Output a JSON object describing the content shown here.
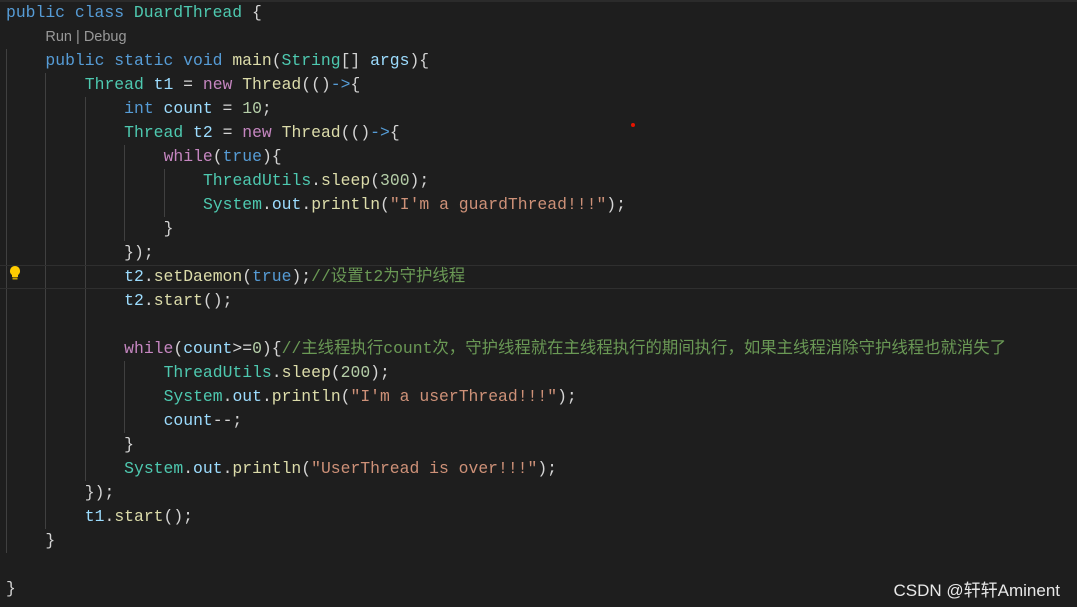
{
  "editor": {
    "colors": {
      "background": "#1e1e1e",
      "keyword": "#569cd6",
      "control": "#c586c0",
      "type": "#4ec9b0",
      "variable": "#9cdcfe",
      "function": "#dcdcaa",
      "string": "#ce9178",
      "number": "#b5cea8",
      "comment": "#6a9955"
    },
    "current_line": 11,
    "lines": [
      {
        "indent": 0,
        "tokens": [
          [
            "public",
            "kw"
          ],
          [
            " ",
            "pl"
          ],
          [
            "class",
            "kw"
          ],
          [
            " ",
            "pl"
          ],
          [
            "DuardThread",
            "ty"
          ],
          [
            " {",
            "pl"
          ]
        ]
      },
      {
        "indent": 1,
        "codelens": [
          "Run",
          "Debug"
        ]
      },
      {
        "indent": 1,
        "tokens": [
          [
            "public",
            "kw"
          ],
          [
            " ",
            "pl"
          ],
          [
            "static",
            "kw"
          ],
          [
            " ",
            "pl"
          ],
          [
            "void",
            "kw"
          ],
          [
            " ",
            "pl"
          ],
          [
            "main",
            "fn"
          ],
          [
            "(",
            "pl"
          ],
          [
            "String",
            "ty"
          ],
          [
            "[] ",
            "pl"
          ],
          [
            "args",
            "var"
          ],
          [
            "){",
            "pl"
          ]
        ]
      },
      {
        "indent": 2,
        "tokens": [
          [
            "Thread",
            "ty"
          ],
          [
            " ",
            "pl"
          ],
          [
            "t1",
            "var"
          ],
          [
            " = ",
            "pl"
          ],
          [
            "new",
            "ctl"
          ],
          [
            " ",
            "pl"
          ],
          [
            "Thread",
            "fn"
          ],
          [
            "(()",
            "pl"
          ],
          [
            "->",
            "kw"
          ],
          [
            "{",
            "pl"
          ]
        ]
      },
      {
        "indent": 3,
        "tokens": [
          [
            "int",
            "kw"
          ],
          [
            " ",
            "pl"
          ],
          [
            "count",
            "var"
          ],
          [
            " = ",
            "pl"
          ],
          [
            "10",
            "num"
          ],
          [
            ";",
            "pl"
          ]
        ]
      },
      {
        "indent": 3,
        "tokens": [
          [
            "Thread",
            "ty"
          ],
          [
            " ",
            "pl"
          ],
          [
            "t2",
            "var"
          ],
          [
            " = ",
            "pl"
          ],
          [
            "new",
            "ctl"
          ],
          [
            " ",
            "pl"
          ],
          [
            "Thread",
            "fn"
          ],
          [
            "(()",
            "pl"
          ],
          [
            "->",
            "kw"
          ],
          [
            "{",
            "pl"
          ]
        ]
      },
      {
        "indent": 4,
        "tokens": [
          [
            "while",
            "ctl"
          ],
          [
            "(",
            "pl"
          ],
          [
            "true",
            "kw"
          ],
          [
            "){",
            "pl"
          ]
        ]
      },
      {
        "indent": 5,
        "tokens": [
          [
            "ThreadUtils",
            "ty"
          ],
          [
            ".",
            "pl"
          ],
          [
            "sleep",
            "fn"
          ],
          [
            "(",
            "pl"
          ],
          [
            "300",
            "num"
          ],
          [
            ");",
            "pl"
          ]
        ]
      },
      {
        "indent": 5,
        "tokens": [
          [
            "System",
            "ty"
          ],
          [
            ".",
            "pl"
          ],
          [
            "out",
            "var"
          ],
          [
            ".",
            "pl"
          ],
          [
            "println",
            "fn"
          ],
          [
            "(",
            "pl"
          ],
          [
            "\"I'm a guardThread!!!\"",
            "str"
          ],
          [
            ");",
            "pl"
          ]
        ]
      },
      {
        "indent": 4,
        "tokens": [
          [
            "}",
            "pl"
          ]
        ]
      },
      {
        "indent": 3,
        "tokens": [
          [
            "});",
            "pl"
          ]
        ]
      },
      {
        "indent": 3,
        "tokens": [
          [
            "t2",
            "var"
          ],
          [
            ".",
            "pl"
          ],
          [
            "setDaemon",
            "fn"
          ],
          [
            "(",
            "pl"
          ],
          [
            "true",
            "kw"
          ],
          [
            ");",
            "pl"
          ],
          [
            "//设置t2为守护线程",
            "cm"
          ]
        ]
      },
      {
        "indent": 3,
        "tokens": [
          [
            "t2",
            "var"
          ],
          [
            ".",
            "pl"
          ],
          [
            "start",
            "fn"
          ],
          [
            "();",
            "pl"
          ]
        ]
      },
      {
        "indent": 3,
        "tokens": []
      },
      {
        "indent": 3,
        "tokens": [
          [
            "while",
            "ctl"
          ],
          [
            "(",
            "pl"
          ],
          [
            "count",
            "var"
          ],
          [
            ">=",
            "pl"
          ],
          [
            "0",
            "num"
          ],
          [
            "){",
            "pl"
          ],
          [
            "//主线程执行count次，守护线程就在主线程执行的期间执行，如果主线程消除守护线程也就消失了",
            "cm"
          ]
        ]
      },
      {
        "indent": 4,
        "tokens": [
          [
            "ThreadUtils",
            "ty"
          ],
          [
            ".",
            "pl"
          ],
          [
            "sleep",
            "fn"
          ],
          [
            "(",
            "pl"
          ],
          [
            "200",
            "num"
          ],
          [
            ");",
            "pl"
          ]
        ]
      },
      {
        "indent": 4,
        "tokens": [
          [
            "System",
            "ty"
          ],
          [
            ".",
            "pl"
          ],
          [
            "out",
            "var"
          ],
          [
            ".",
            "pl"
          ],
          [
            "println",
            "fn"
          ],
          [
            "(",
            "pl"
          ],
          [
            "\"I'm a userThread!!!\"",
            "str"
          ],
          [
            ");",
            "pl"
          ]
        ]
      },
      {
        "indent": 4,
        "tokens": [
          [
            "count",
            "var"
          ],
          [
            "--;",
            "pl"
          ]
        ]
      },
      {
        "indent": 3,
        "tokens": [
          [
            "}",
            "pl"
          ]
        ]
      },
      {
        "indent": 3,
        "tokens": [
          [
            "System",
            "ty"
          ],
          [
            ".",
            "pl"
          ],
          [
            "out",
            "var"
          ],
          [
            ".",
            "pl"
          ],
          [
            "println",
            "fn"
          ],
          [
            "(",
            "pl"
          ],
          [
            "\"UserThread is over!!!\"",
            "str"
          ],
          [
            ");",
            "pl"
          ]
        ]
      },
      {
        "indent": 2,
        "tokens": [
          [
            "});",
            "pl"
          ]
        ]
      },
      {
        "indent": 2,
        "tokens": [
          [
            "t1",
            "var"
          ],
          [
            ".",
            "pl"
          ],
          [
            "start",
            "fn"
          ],
          [
            "();",
            "pl"
          ]
        ]
      },
      {
        "indent": 1,
        "tokens": [
          [
            "}",
            "pl"
          ]
        ]
      },
      {
        "indent": 0,
        "tokens": []
      },
      {
        "indent": 0,
        "tokens": [
          [
            "}",
            "pl"
          ]
        ]
      }
    ]
  },
  "lightbulb_icon": "lightbulb-icon",
  "watermark": "CSDN @轩轩Aminent"
}
